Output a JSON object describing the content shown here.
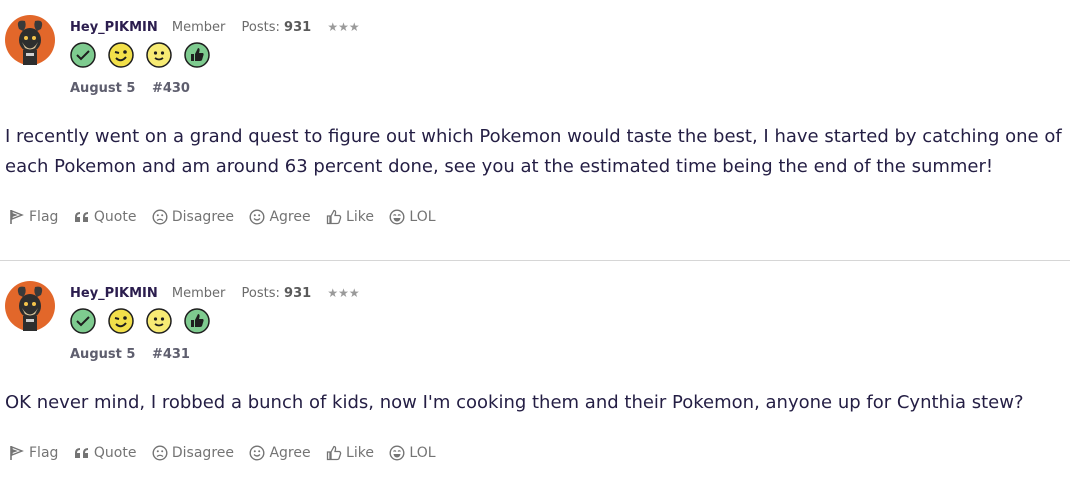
{
  "posts": [
    {
      "username": "Hey_PIKMIN",
      "role": "Member",
      "posts_label": "Posts:",
      "posts_count": "931",
      "stars": "★★★",
      "date": "August 5",
      "post_number": "#430",
      "body": "I recently went on a grand quest to figure out which Pokemon would taste the best, I have started by catching one of each Pokemon and am around 63 percent done, see you at the estimated time being the end of the summer!"
    },
    {
      "username": "Hey_PIKMIN",
      "role": "Member",
      "posts_label": "Posts:",
      "posts_count": "931",
      "stars": "★★★",
      "date": "August 5",
      "post_number": "#431",
      "body": "OK never mind, I robbed a bunch of kids, now I'm cooking them and their Pokemon, anyone up for Cynthia stew?"
    }
  ],
  "actions": {
    "flag": "Flag",
    "quote": "Quote",
    "disagree": "Disagree",
    "agree": "Agree",
    "like": "Like",
    "lol": "LOL"
  },
  "icons": {
    "badges": [
      "check-badge-icon",
      "wink-badge-icon",
      "smile-badge-icon",
      "thumbs-up-badge-icon"
    ],
    "actions": [
      "flag-icon",
      "quote-icon",
      "frown-icon",
      "smile-icon",
      "thumbs-up-icon",
      "laugh-icon"
    ]
  },
  "colors": {
    "username": "#2b1d4e",
    "badge_green": "#7ecb8f",
    "badge_yellow": "#f2e04a",
    "action_text": "#747474"
  }
}
